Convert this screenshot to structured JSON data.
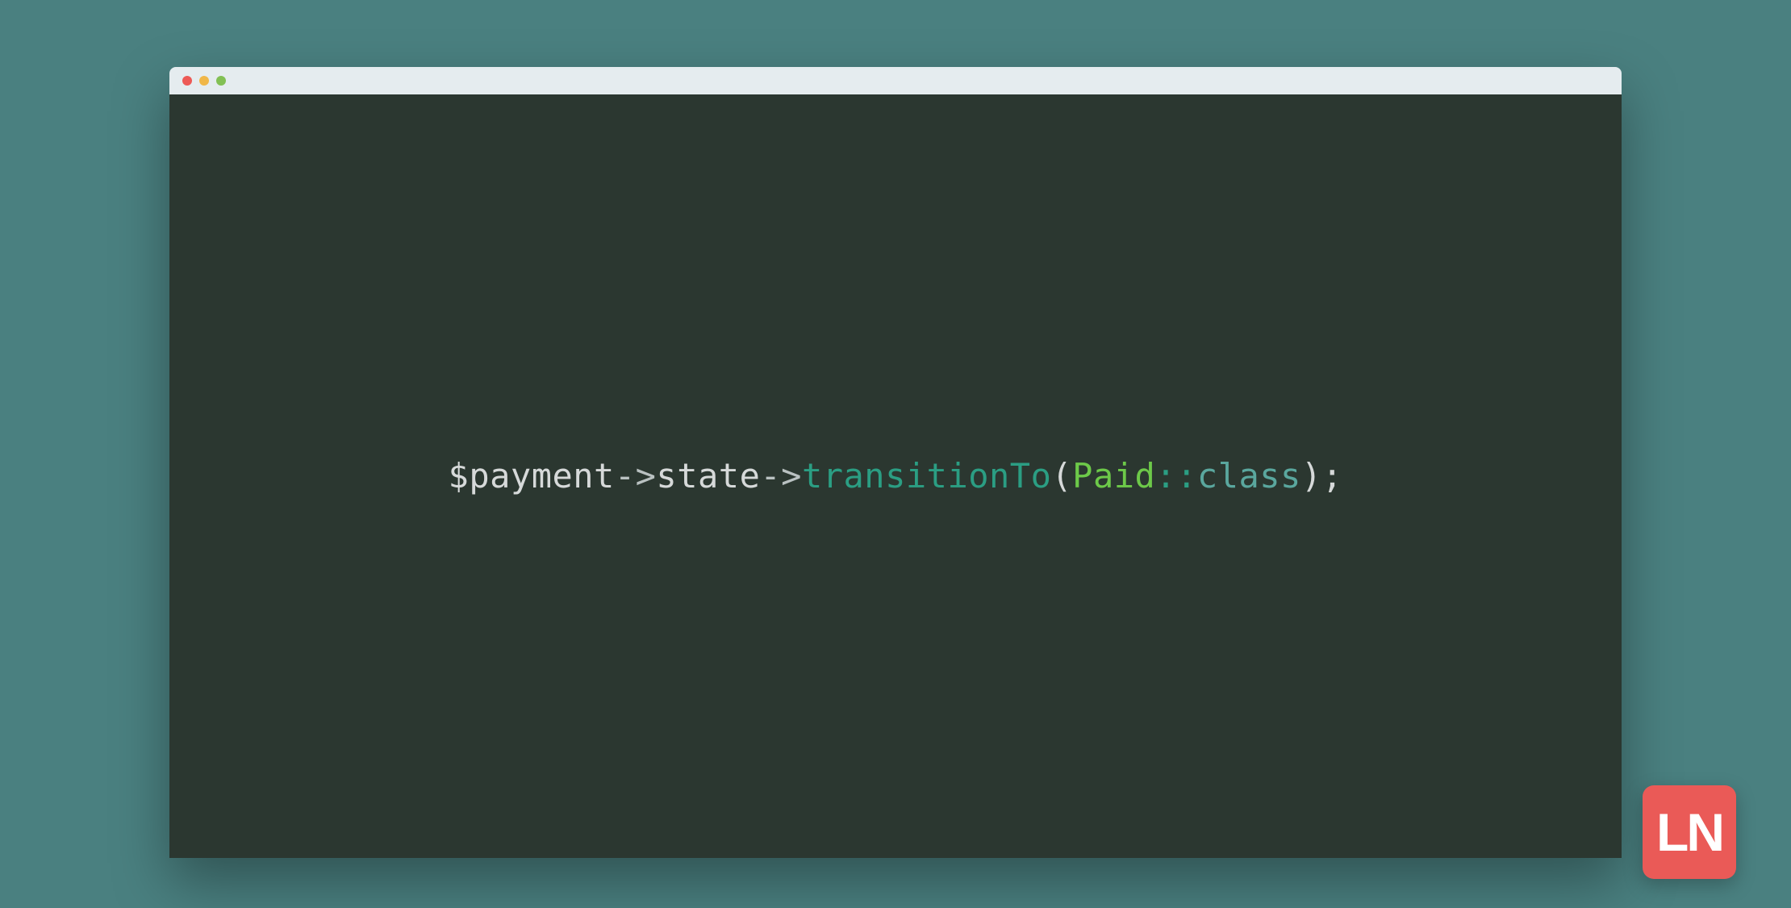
{
  "window": {
    "traffic_lights": {
      "red": "#ed5a56",
      "yellow": "#f0b748",
      "green": "#82c054"
    }
  },
  "code": {
    "tokens": {
      "t1": "$payment",
      "t2": "->",
      "t3": "state",
      "t4": "->",
      "t5": "transitionTo",
      "t6": "(",
      "t7": "Paid",
      "t8": "::",
      "t9": "class",
      "t10": ")",
      "t11": ";"
    }
  },
  "logo": {
    "text": "LN"
  },
  "colors": {
    "page_bg": "#4a8080",
    "editor_bg": "#2b3730",
    "titlebar_bg": "#e5ecef",
    "badge_bg": "#ea5a57"
  }
}
